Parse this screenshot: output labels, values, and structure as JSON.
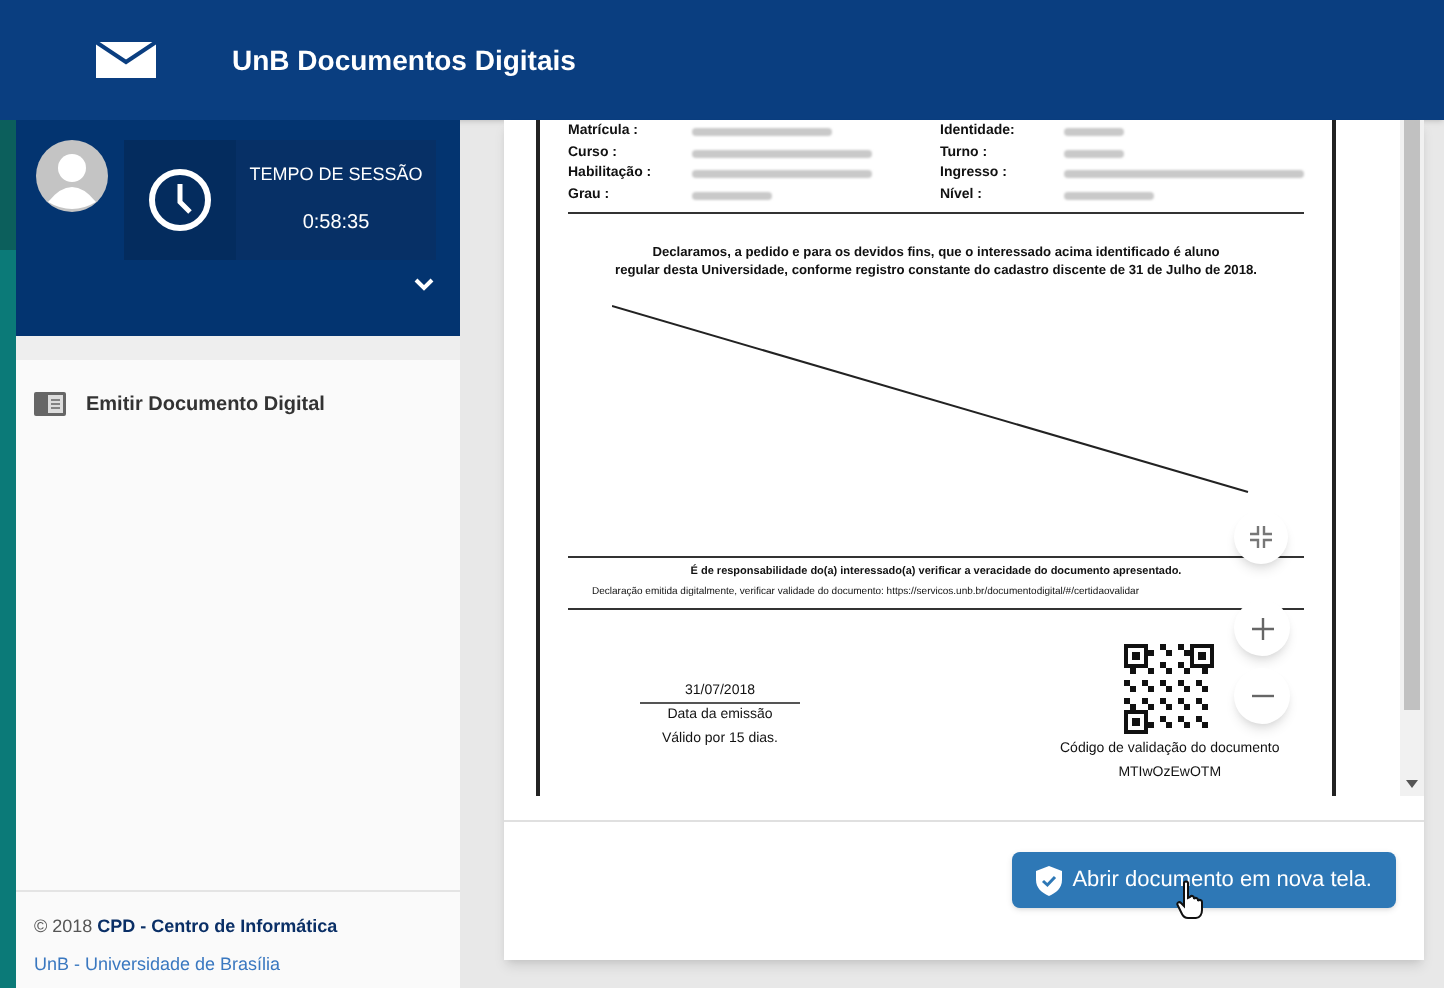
{
  "header": {
    "title": "UnB Documentos Digitais"
  },
  "session": {
    "label": "TEMPO DE SESSÃO",
    "time": "0:58:35"
  },
  "menu": [
    {
      "label": "Emitir Documento Digital"
    }
  ],
  "footer": {
    "copyright": "© 2018 **CPD - Centro de Informática**",
    "link": "UnB - Universidade de Brasília"
  },
  "document": {
    "fields_left": [
      {
        "label": "Matrícula :"
      },
      {
        "label": "Curso :"
      },
      {
        "label": "Habilitação :"
      },
      {
        "label": "Grau :"
      }
    ],
    "fields_right": [
      {
        "label": "Identidade:"
      },
      {
        "label": "Turno :"
      },
      {
        "label": "Ingresso :"
      },
      {
        "label": "Nível :"
      }
    ],
    "declaration": [
      "Declaramos, a pedido e para os devidos fins, que o interessado acima identificado é aluno",
      "regular desta Universidade, conforme registro constante do cadastro discente de 31 de Julho de 2018."
    ],
    "responsibility": "É de responsabilidade do(a) interessado(a) verificar a veracidade do documento apresentado.",
    "validation_note": "Declaração emitida digitalmente, verificar validade do documento: https://servicos.unb.br/documentodigital/#/certidaovalidar",
    "date": "31/07/2018",
    "date_label": "Data da emissão",
    "validity": "Válido por 15 dias.",
    "code_label": "Código de validação do documento",
    "code": "MTIwOzEwOTM"
  },
  "open_button": {
    "label": "Abrir documento em nova tela."
  }
}
